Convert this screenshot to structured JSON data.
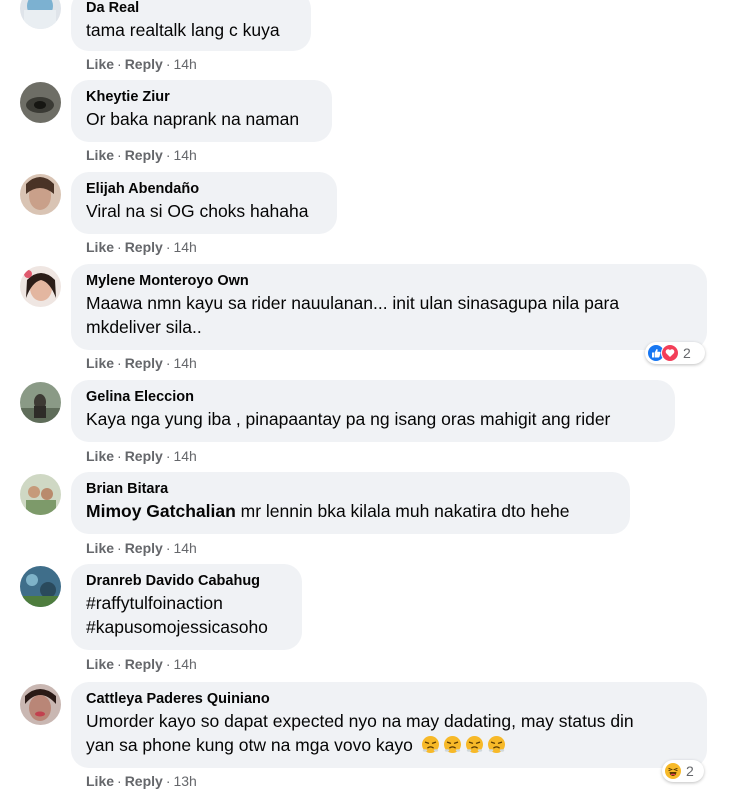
{
  "actions": {
    "like": "Like",
    "reply": "Reply",
    "dot": "·"
  },
  "comments": [
    {
      "name": "Da Real",
      "lines": [
        "tama realtalk lang c kuya"
      ],
      "time": "14h"
    },
    {
      "name": "Kheytie Ziur",
      "lines": [
        "Or baka naprank na naman"
      ],
      "time": "14h"
    },
    {
      "name": "Elijah Abendaño",
      "lines": [
        "Viral na si OG choks hahaha"
      ],
      "time": "14h"
    },
    {
      "name": "Mylene Monteroyo Own",
      "lines": [
        "Maawa nmn kayu sa rider nauulanan... init ulan sinasagupa nila para",
        "mkdeliver sila.."
      ],
      "time": "14h",
      "reaction_count": "2",
      "reaction_icons": [
        "like-icon",
        "love-icon"
      ]
    },
    {
      "name": "Gelina Eleccion",
      "lines": [
        "Kaya nga yung iba , pinapaantay pa ng isang oras mahigit ang rider"
      ],
      "time": "14h"
    },
    {
      "name": "Brian Bitara",
      "mention": "Mimoy Gatchalian",
      "text": " mr lennin bka kilala muh nakatira dto hehe",
      "time": "14h"
    },
    {
      "name": "Dranreb Davido Cabahug",
      "lines": [
        "#raffytulfoinaction",
        "#kapusomojessicasoho"
      ],
      "time": "14h"
    },
    {
      "name": "Cattleya Paderes Quiniano",
      "lines": [
        "Umorder kayo so dapat expected nyo na may dadating, may status din",
        "yan sa phone kung otw na mga vovo kayo"
      ],
      "emoji_icon": "huffing-face-emoji",
      "time": "13h",
      "reaction_count": "2",
      "reaction_icons": [
        "haha-icon"
      ]
    }
  ],
  "colors": {
    "bubble": "#f0f2f5",
    "meta": "#65676b",
    "like_blue": "#1877f2",
    "love_red": "#f33e58",
    "haha_yellow": "#f7b928"
  }
}
